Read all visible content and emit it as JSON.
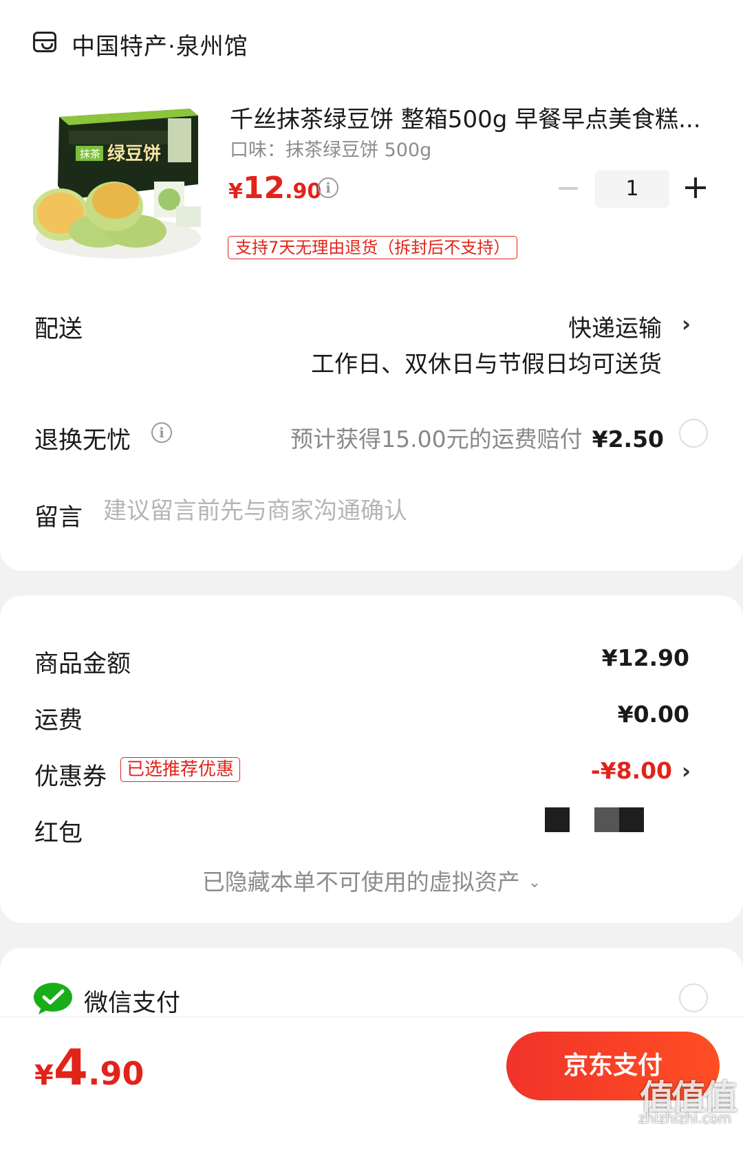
{
  "shop": {
    "name": "中国特产·泉州馆",
    "icon": "store-icon"
  },
  "product": {
    "title": "千丝抹茶绿豆饼 整箱500g 早餐早点美食糕...",
    "spec": "口味：抹茶绿豆饼 500g",
    "price_symbol": "¥",
    "price_int": "12",
    "price_dec": ".90",
    "quantity": "1",
    "return_tag": "支持7天无理由退货（拆封后不支持）"
  },
  "delivery": {
    "label": "配送",
    "method": "快递运输",
    "schedule": "工作日、双休日与节假日均可送货"
  },
  "return_worry": {
    "label": "退换无忧",
    "desc": "预计获得15.00元的运费赔付",
    "price": "¥2.50"
  },
  "message": {
    "label": "留言",
    "placeholder": "建议留言前先与商家沟通确认"
  },
  "summary": {
    "goods_label": "商品金额",
    "goods_value": "¥12.90",
    "shipping_label": "运费",
    "shipping_value": "¥0.00",
    "coupon_label": "优惠券",
    "coupon_tag": "已选推荐优惠",
    "coupon_value": "-¥8.00",
    "redpacket_label": "红包",
    "hidden_note": "已隐藏本单不可使用的虚拟资产"
  },
  "payment": {
    "wechat_label": "微信支付"
  },
  "bottom": {
    "total_symbol": "¥",
    "total_int": "4",
    "total_dec": ".90",
    "pay_button": "京东支付"
  },
  "watermark": {
    "text": "值值值",
    "url": "zhizhizhi.com"
  },
  "colors": {
    "accent": "#e2231a",
    "wechat": "#1aad19"
  }
}
